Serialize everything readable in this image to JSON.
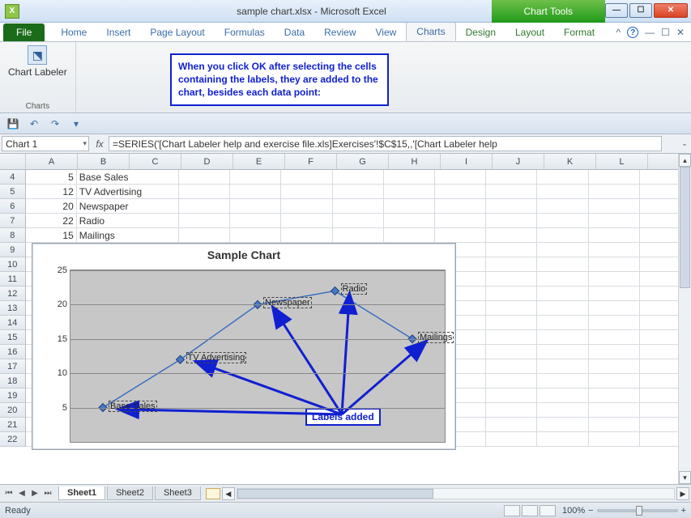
{
  "window": {
    "title": "sample chart.xlsx - Microsoft Excel",
    "chart_tools": "Chart Tools"
  },
  "ribbon_tabs": {
    "file": "File",
    "home": "Home",
    "insert": "Insert",
    "page_layout": "Page Layout",
    "formulas": "Formulas",
    "data": "Data",
    "review": "Review",
    "view": "View",
    "charts": "Charts",
    "design": "Design",
    "layout": "Layout",
    "format": "Format"
  },
  "ribbon_group": {
    "chart_labeler": "Chart Labeler",
    "group_label": "Charts"
  },
  "instruction": "When you click OK after selecting the cells containing the labels, they are added to the chart, besides each data point:",
  "namebox": "Chart 1",
  "formula": "=SERIES('[Chart Labeler help and exercise file.xls]Exercises'!$C$15,,'[Chart Labeler help",
  "columns": [
    "A",
    "B",
    "C",
    "D",
    "E",
    "F",
    "G",
    "H",
    "I",
    "J",
    "K",
    "L"
  ],
  "rows": [
    {
      "n": "4",
      "a": "5",
      "b": "Base Sales"
    },
    {
      "n": "5",
      "a": "12",
      "b": "TV Advertising"
    },
    {
      "n": "6",
      "a": "20",
      "b": "Newspaper"
    },
    {
      "n": "7",
      "a": "22",
      "b": "Radio"
    },
    {
      "n": "8",
      "a": "15",
      "b": "Mailings"
    },
    {
      "n": "9"
    },
    {
      "n": "10"
    },
    {
      "n": "11"
    },
    {
      "n": "12"
    },
    {
      "n": "13"
    },
    {
      "n": "14"
    },
    {
      "n": "15"
    },
    {
      "n": "16"
    },
    {
      "n": "17"
    },
    {
      "n": "18"
    },
    {
      "n": "19"
    },
    {
      "n": "20"
    },
    {
      "n": "21"
    },
    {
      "n": "22"
    }
  ],
  "chart_data": {
    "type": "line",
    "title": "Sample Chart",
    "categories": [
      "Base Sales",
      "TV Advertising",
      "Newspaper",
      "Radio",
      "Mailings"
    ],
    "values": [
      5,
      12,
      20,
      22,
      15
    ],
    "ylim": [
      0,
      25
    ],
    "yticks": [
      5,
      10,
      15,
      20,
      25
    ],
    "annotation": "Labels added"
  },
  "sheet_tabs": {
    "s1": "Sheet1",
    "s2": "Sheet2",
    "s3": "Sheet3"
  },
  "status": {
    "ready": "Ready",
    "zoom": "100%"
  }
}
